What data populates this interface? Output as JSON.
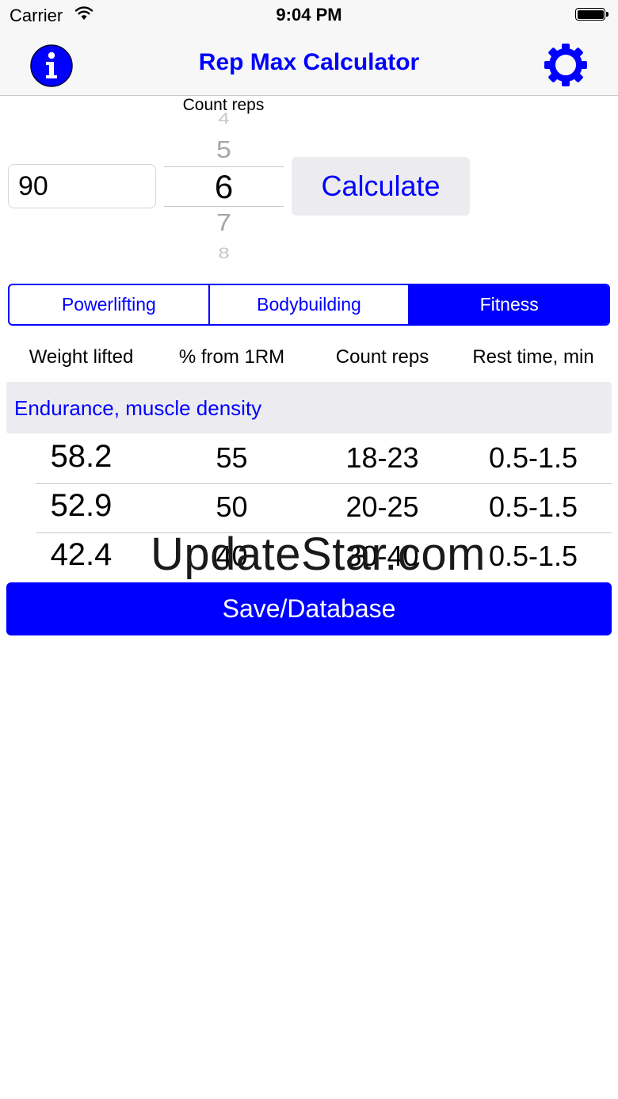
{
  "status_bar": {
    "carrier": "Carrier",
    "time": "9:04 PM"
  },
  "nav": {
    "title": "Rep Max Calculator",
    "info_icon": "info-icon",
    "settings_icon": "gear-icon"
  },
  "input": {
    "weight_value": "90"
  },
  "picker": {
    "label": "Count reps",
    "options": [
      "4",
      "5",
      "6",
      "7",
      "8"
    ],
    "selected": "6"
  },
  "calculate_label": "Calculate",
  "tabs": [
    {
      "label": "Powerlifting",
      "active": false
    },
    {
      "label": "Bodybuilding",
      "active": false
    },
    {
      "label": "Fitness",
      "active": true
    }
  ],
  "table": {
    "columns": [
      "Weight lifted",
      "% from 1RM",
      "Count reps",
      "Rest time, min"
    ],
    "section_title": "Endurance, muscle density",
    "rows": [
      {
        "weight": "58.2",
        "percent": "55",
        "reps": "18-23",
        "rest": "0.5-1.5"
      },
      {
        "weight": "52.9",
        "percent": "50",
        "reps": "20-25",
        "rest": "0.5-1.5"
      },
      {
        "weight": "42.4",
        "percent": "40",
        "reps": "30-40",
        "rest": "0.5-1.5"
      }
    ]
  },
  "watermark": "UpdateStar.com",
  "save_label": "Save/Database",
  "colors": {
    "accent": "#0000ff",
    "bar_bg": "#f7f7f7",
    "button_bg": "#ececf0"
  }
}
